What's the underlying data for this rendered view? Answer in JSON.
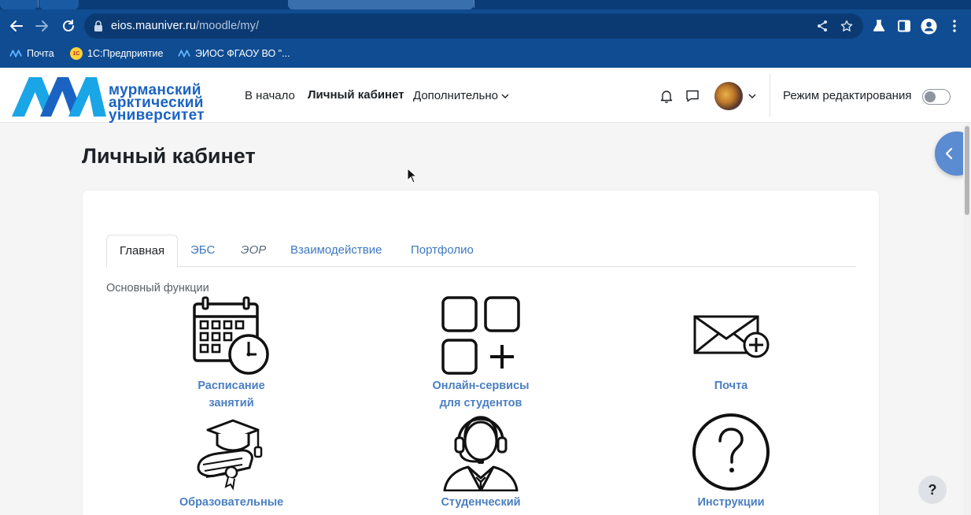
{
  "browser": {
    "url_host": "eios.mauniver.ru",
    "url_path": "/moodle/my/",
    "bookmarks": [
      {
        "label": "Почта",
        "icon": "mauniver-icon"
      },
      {
        "label": "1С:Предприятие",
        "icon": "1c-icon"
      },
      {
        "label": "ЭИОС ФГАОУ ВО \"...",
        "icon": "mauniver-icon"
      }
    ],
    "bookmark_1c_badge": "1С"
  },
  "site": {
    "logo_lines": [
      "мурманский",
      "арктический",
      "университет"
    ],
    "nav": {
      "home": "В начало",
      "dashboard": "Личный кабинет",
      "more": "Дополнительно"
    },
    "edit_mode_label": "Режим редактирования",
    "edit_mode_on": false
  },
  "page": {
    "title": "Личный кабинет",
    "tabs": [
      {
        "label": "Главная",
        "active": true
      },
      {
        "label": "ЭБС",
        "active": false
      },
      {
        "label": "ЭОР",
        "active": false
      },
      {
        "label": "Взаимодействие",
        "active": false
      },
      {
        "label": "Портфолио",
        "active": false
      }
    ],
    "section_label": "Основный функции",
    "tiles": [
      {
        "line1": "Расписание",
        "line2": "занятий",
        "icon": "calendar-clock-icon"
      },
      {
        "line1": "Онлайн-сервисы",
        "line2": "для студентов",
        "icon": "apps-grid-add-icon"
      },
      {
        "line1": "Почта",
        "line2": "",
        "icon": "mail-add-icon"
      },
      {
        "line1": "Образовательные",
        "line2": "",
        "icon": "graduation-cap-diploma-icon"
      },
      {
        "line1": "Студенческий",
        "line2": "",
        "icon": "support-headset-icon"
      },
      {
        "line1": "Инструкции",
        "line2": "",
        "icon": "question-circle-icon"
      }
    ],
    "help_label": "?"
  },
  "colors": {
    "browser_blue": "#0f4c92",
    "link_blue": "#3e78c2",
    "caption_blue": "#4a7fc1",
    "logo_blue": "#1a63c2"
  }
}
